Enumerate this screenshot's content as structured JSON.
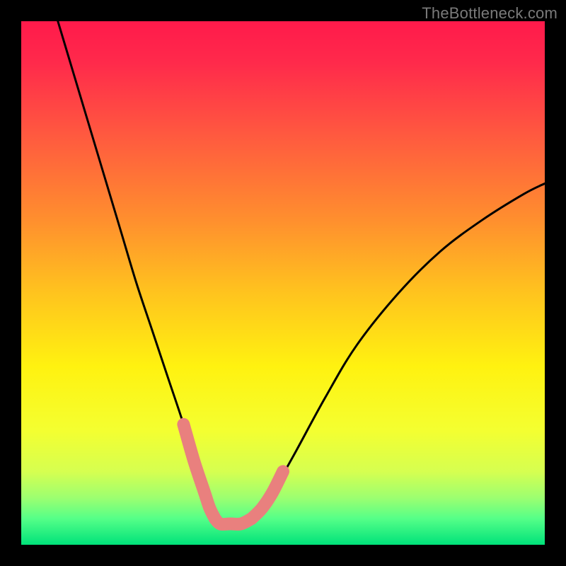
{
  "watermark": {
    "text": "TheBottleneck.com"
  },
  "chart_data": {
    "type": "line",
    "title": "",
    "xlabel": "",
    "ylabel": "",
    "xlim": [
      0,
      100
    ],
    "ylim": [
      0,
      100
    ],
    "series": [
      {
        "name": "bottleneck-curve",
        "x": [
          7,
          10,
          13,
          16,
          19,
          22,
          25,
          28,
          31,
          33,
          35,
          36,
          37,
          38,
          40,
          42,
          44,
          46,
          48,
          52,
          58,
          64,
          72,
          80,
          88,
          96,
          100
        ],
        "y": [
          100,
          90,
          80,
          70,
          60,
          50,
          41,
          32,
          23,
          16,
          10,
          7,
          5,
          4,
          4,
          4,
          5,
          7,
          10,
          17,
          28,
          38,
          48,
          56,
          62,
          67,
          69
        ]
      }
    ],
    "highlight_segments": [
      {
        "name": "left-pink-band",
        "x": [
          31,
          33,
          35,
          36,
          37
        ],
        "y": [
          23,
          16,
          10,
          7,
          5
        ]
      },
      {
        "name": "right-pink-band",
        "x": [
          44,
          46,
          48,
          50
        ],
        "y": [
          5,
          7,
          10,
          14
        ]
      },
      {
        "name": "trough-pink-band",
        "x": [
          37,
          38,
          40,
          42,
          44
        ],
        "y": [
          5,
          4,
          4,
          4,
          5
        ]
      }
    ],
    "gradient_stops": [
      {
        "offset": 0.0,
        "color": "#ff1a4b"
      },
      {
        "offset": 0.08,
        "color": "#ff2a4b"
      },
      {
        "offset": 0.22,
        "color": "#ff5a3f"
      },
      {
        "offset": 0.38,
        "color": "#ff8f2e"
      },
      {
        "offset": 0.52,
        "color": "#ffc41e"
      },
      {
        "offset": 0.66,
        "color": "#fff210"
      },
      {
        "offset": 0.78,
        "color": "#f4ff30"
      },
      {
        "offset": 0.86,
        "color": "#d6ff50"
      },
      {
        "offset": 0.91,
        "color": "#9dff70"
      },
      {
        "offset": 0.95,
        "color": "#55ff88"
      },
      {
        "offset": 1.0,
        "color": "#00e27a"
      }
    ]
  }
}
